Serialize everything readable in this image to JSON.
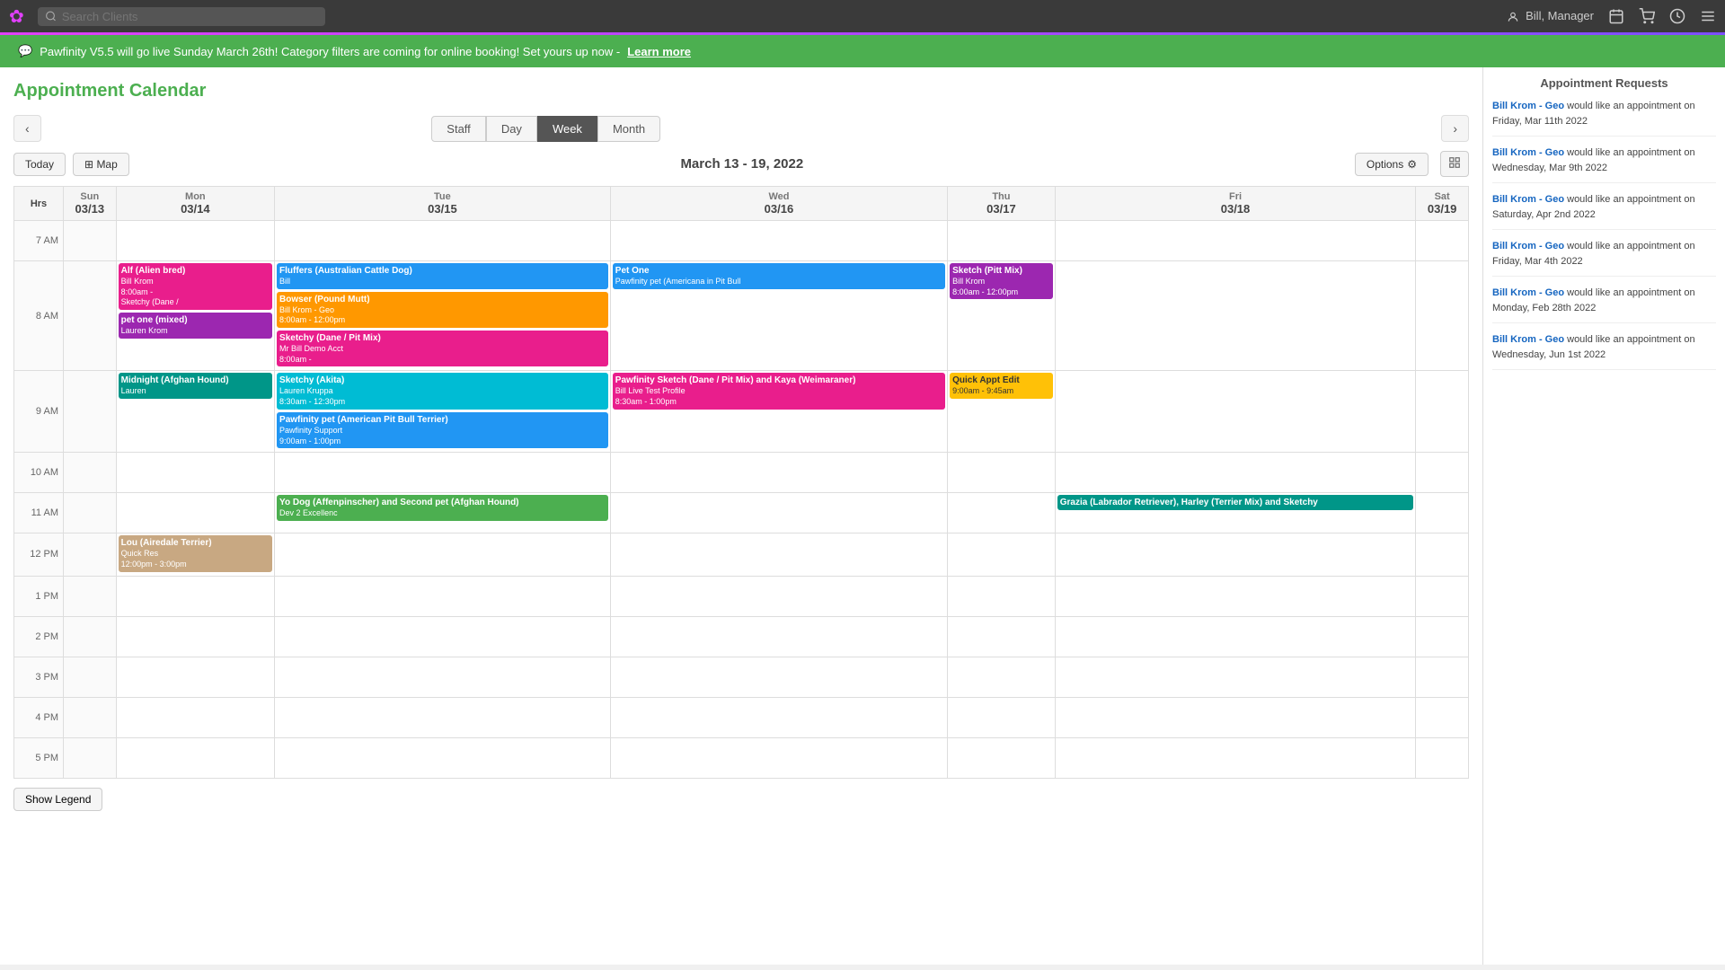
{
  "nav": {
    "logo": "✿",
    "search_placeholder": "Search Clients",
    "user": "Bill, Manager",
    "icons": [
      "calendar",
      "cart",
      "clock",
      "menu"
    ]
  },
  "notification": {
    "message": "Pawfinity V5.5 will go live Sunday March 26th! Category filters are coming for online booking! Set yours up now -",
    "link_text": "Learn more"
  },
  "calendar": {
    "title": "Appointment Calendar",
    "week_label": "March 13 - 19, 2022",
    "view_tabs": [
      "Staff",
      "Day",
      "Week",
      "Month"
    ],
    "active_tab": "Week",
    "today_btn": "Today",
    "map_btn": "Map",
    "options_btn": "Options",
    "show_legend_btn": "Show Legend",
    "days": [
      {
        "day": "Sun",
        "date": "03/13"
      },
      {
        "day": "Mon",
        "date": "03/14"
      },
      {
        "day": "Tue",
        "date": "03/15"
      },
      {
        "day": "Wed",
        "date": "03/16"
      },
      {
        "day": "Thu",
        "date": "03/17"
      },
      {
        "day": "Fri",
        "date": "03/18"
      },
      {
        "day": "Sat",
        "date": "03/19"
      }
    ],
    "hours": [
      "7 AM",
      "8 AM",
      "9 AM",
      "10 AM",
      "11 AM",
      "12 PM",
      "1 PM",
      "2 PM",
      "3 PM",
      "4 PM",
      "5 PM"
    ]
  },
  "appointment_requests": {
    "title": "Appointment Requests",
    "items": [
      {
        "client": "Bill Krom - Geo",
        "text": "would like an appointment on Friday, Mar 11th 2022"
      },
      {
        "client": "Bill Krom - Geo",
        "text": "would like an appointment on Wednesday, Mar 9th 2022"
      },
      {
        "client": "Bill Krom - Geo",
        "text": "would like an appointment on Saturday, Apr 2nd 2022"
      },
      {
        "client": "Bill Krom - Geo",
        "text": "would like an appointment on Friday, Mar 4th 2022"
      },
      {
        "client": "Bill Krom - Geo",
        "text": "would like an appointment on Monday, Feb 28th 2022"
      },
      {
        "client": "Bill Krom - Geo",
        "text": "would like an appointment on Wednesday, Jun 1st 2022"
      }
    ]
  }
}
